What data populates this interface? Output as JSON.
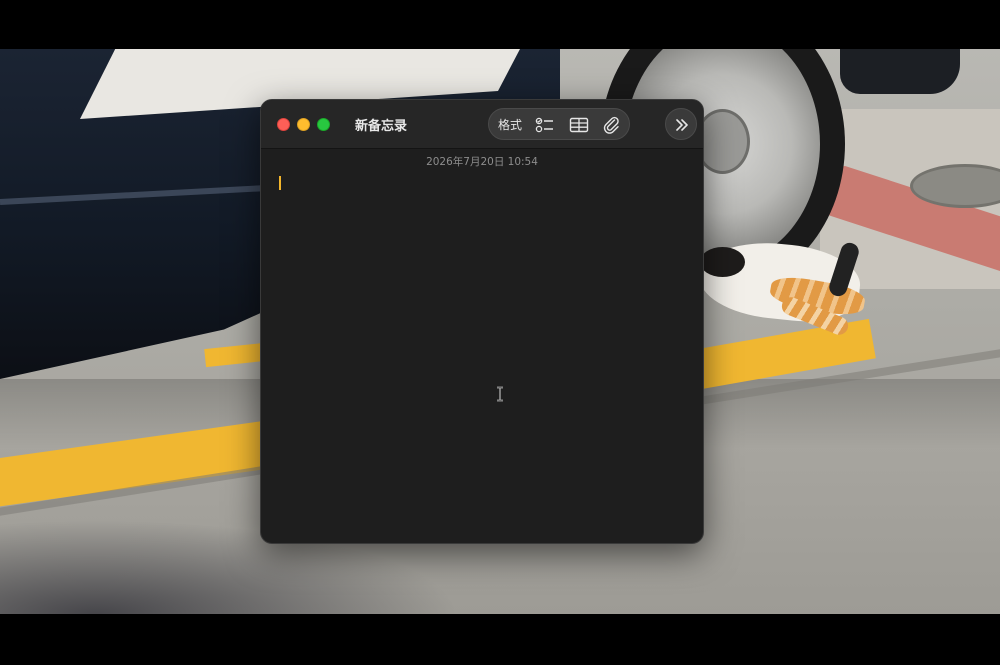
{
  "window": {
    "title": "新备忘录",
    "date": "2026年7月20日 10:54"
  },
  "toolbar": {
    "format_label": "格式",
    "icons": [
      "checklist-icon",
      "table-icon",
      "attachment-icon"
    ],
    "more_icon": "chevron-double-right-icon"
  },
  "note": {
    "body": ""
  },
  "colors": {
    "window_bg": "#1e1e1e",
    "titlebar_bg": "#262626",
    "caret": "#f3b52b",
    "close": "#fe5f57",
    "minimize": "#febc2e",
    "zoom": "#28c840"
  }
}
